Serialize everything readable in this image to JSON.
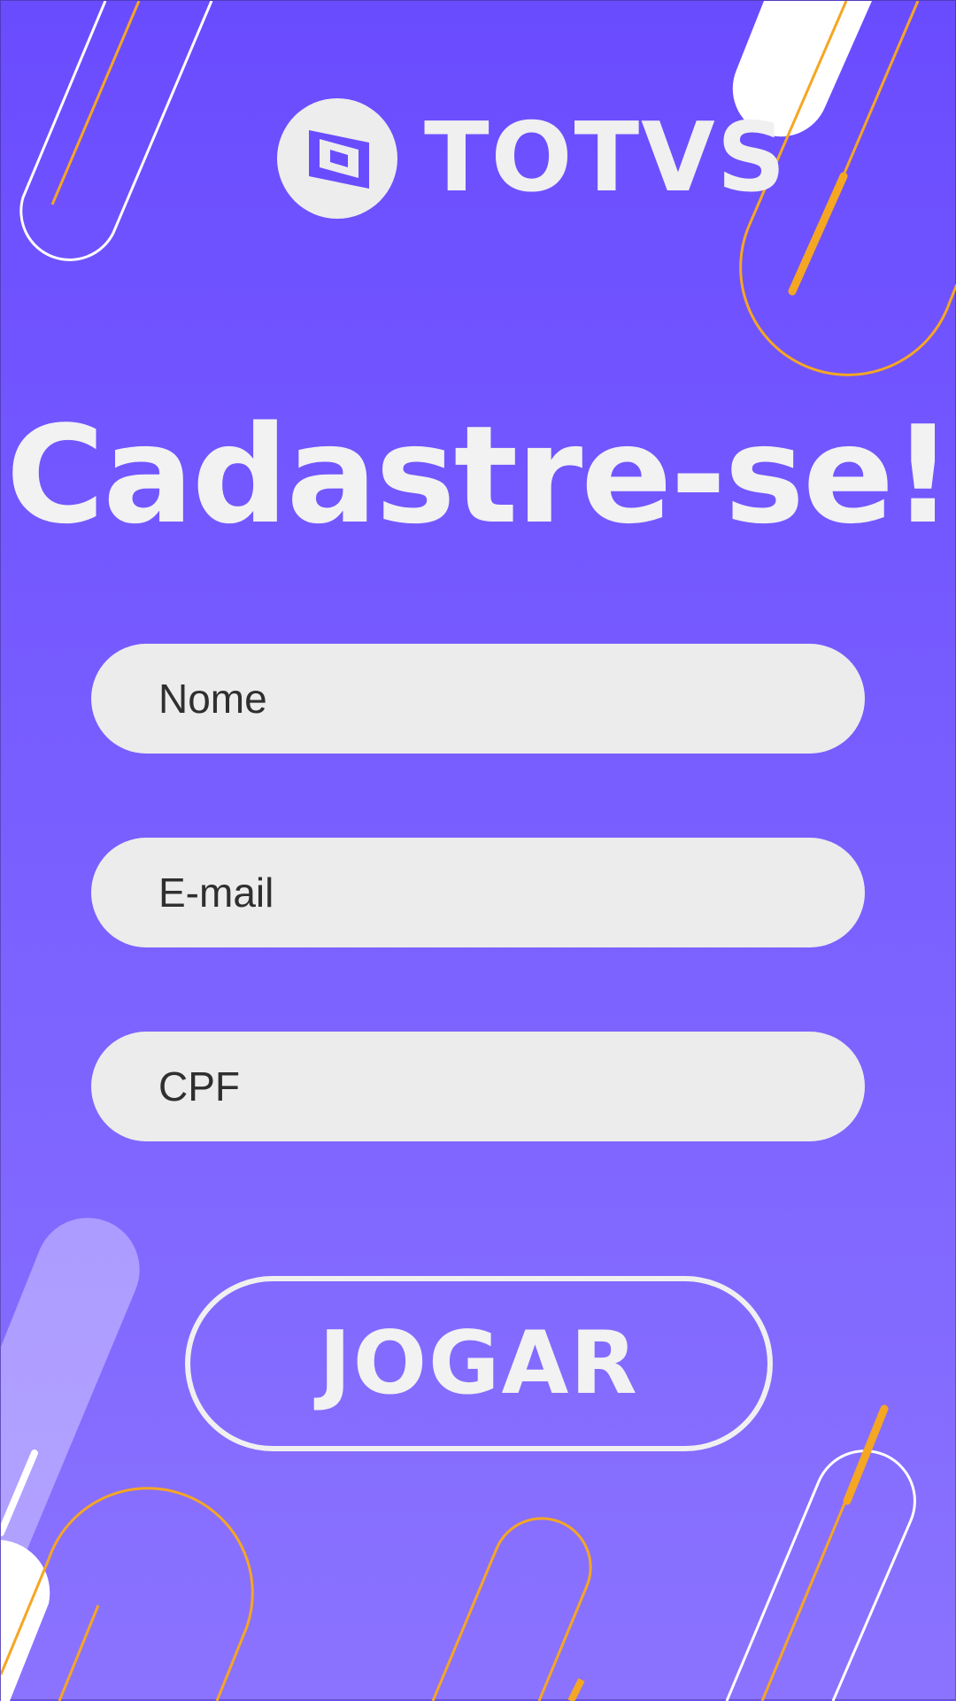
{
  "brand": {
    "name": "TOTVS",
    "logo_icon": "totvs-logo-icon"
  },
  "page": {
    "title": "Cadastre-se!"
  },
  "form": {
    "name_placeholder": "Nome",
    "email_placeholder": "E-mail",
    "cpf_placeholder": "CPF"
  },
  "actions": {
    "play_label": "JOGAR"
  },
  "colors": {
    "background_top": "#6a4cff",
    "background_bottom": "#8b73ff",
    "accent_orange": "#f5a623",
    "text_light": "#f2f2f2",
    "field_bg": "#ececec"
  }
}
